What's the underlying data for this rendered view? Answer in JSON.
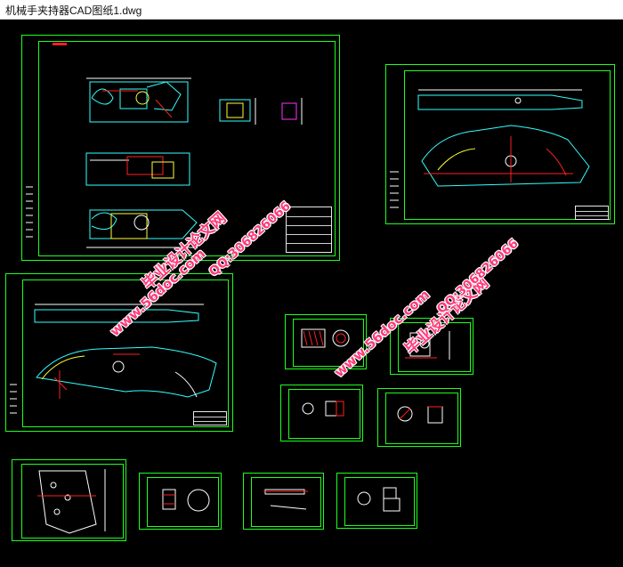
{
  "window": {
    "title": "机械手夹持器CAD图纸1.dwg"
  },
  "watermarks": {
    "site": "www.56doc.com",
    "name": "毕业设计论文网",
    "qq": "QQ:306826066"
  },
  "colors": {
    "frame": "#1eff1e",
    "line_cyan": "#33ffff",
    "line_white": "#ffffff",
    "line_red": "#ff2020",
    "line_magenta": "#ff33ff",
    "line_yellow": "#ffff33",
    "watermark": "#ff3a7a"
  },
  "sheets": [
    {
      "id": "sheet-1-assembly"
    },
    {
      "id": "sheet-2-finger"
    },
    {
      "id": "sheet-3-lever"
    },
    {
      "id": "sheet-4-spring"
    },
    {
      "id": "sheet-5-bracket"
    },
    {
      "id": "sheet-6-ring"
    },
    {
      "id": "sheet-7-ring-cut"
    },
    {
      "id": "sheet-8-plate"
    },
    {
      "id": "sheet-9-disc"
    },
    {
      "id": "sheet-10-pin"
    },
    {
      "id": "sheet-11-bushing"
    }
  ]
}
